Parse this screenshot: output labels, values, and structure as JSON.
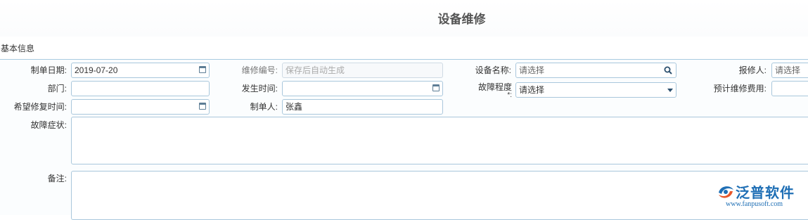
{
  "page": {
    "title": "设备维修"
  },
  "section": {
    "title": "基本信息"
  },
  "form": {
    "create_date": {
      "label": "制单日期:",
      "value": "2019-07-20"
    },
    "repair_no": {
      "label": "维修编号:",
      "placeholder": "保存后自动生成"
    },
    "device_name": {
      "label": "设备名称:",
      "placeholder": "请选择"
    },
    "reporter": {
      "label": "报修人:",
      "placeholder": "请选择"
    },
    "department": {
      "label": "部门:",
      "value": ""
    },
    "occur_time": {
      "label": "发生时间:",
      "value": ""
    },
    "fault_level": {
      "label": "故障程度",
      "required_mark": "*:",
      "value": "请选择"
    },
    "estimated_cost": {
      "label": "预计维修费用:",
      "value": ""
    },
    "expected_repair_time": {
      "label": "希望修复时间:",
      "value": ""
    },
    "creator": {
      "label": "制单人:",
      "value": "张鑫"
    },
    "fault_symptom": {
      "label": "故障症状:"
    },
    "remark": {
      "label": "备注:"
    }
  },
  "logo": {
    "name": "泛普软件",
    "url": "www.fanpusoft.com"
  },
  "colors": {
    "border": "#a9c7dc",
    "brand": "#1f6fb5",
    "logo_accent": "#e8572a"
  }
}
